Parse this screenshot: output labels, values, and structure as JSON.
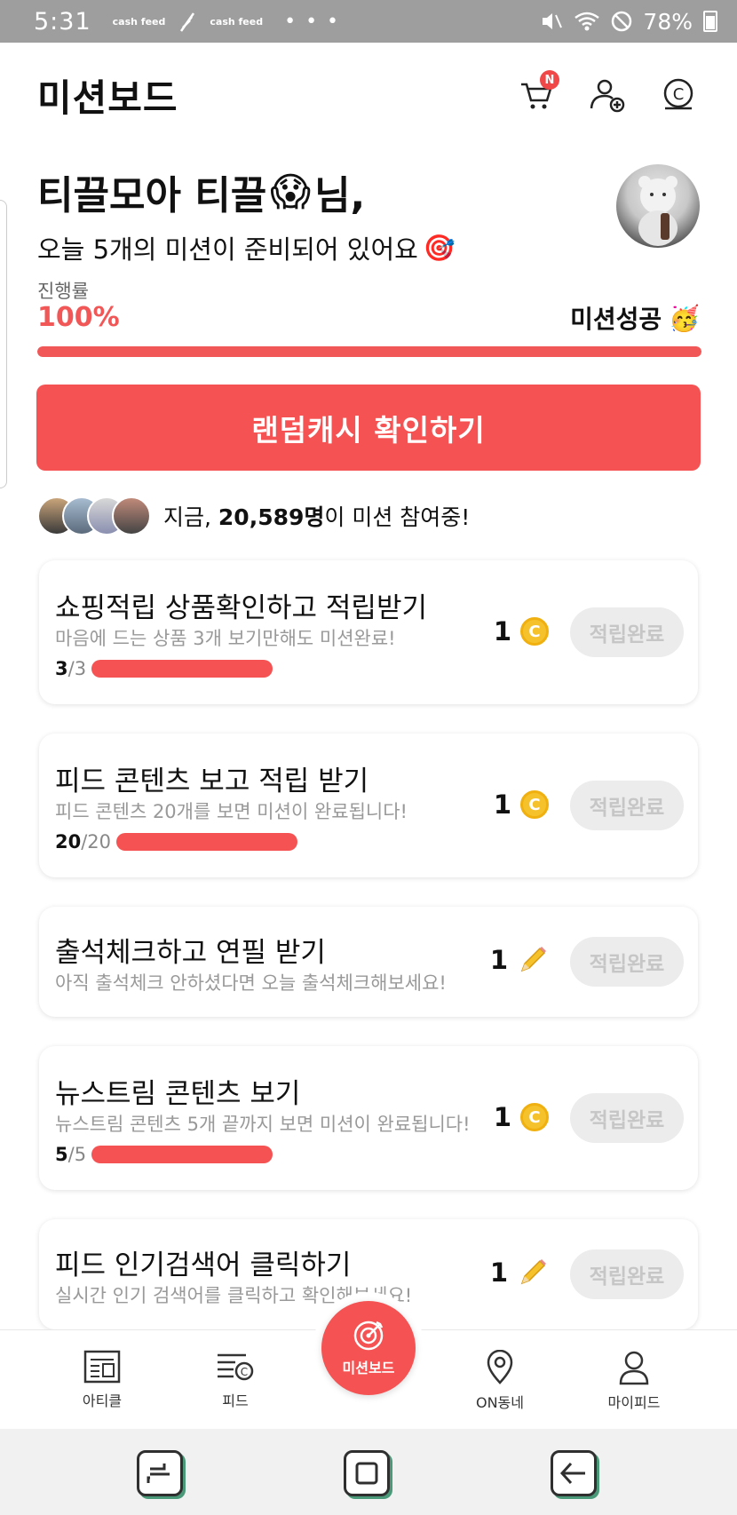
{
  "status_bar": {
    "time": "5:31",
    "notif_chips": [
      "cash feed",
      "cash feed"
    ],
    "more": "• • •",
    "battery": "78%"
  },
  "header": {
    "title": "미션보드",
    "cart_badge": "N"
  },
  "greeting": {
    "name": "티끌모아 티끌",
    "name_suffix": "님,",
    "emoji": "😱",
    "subtitle": "오늘 5개의 미션이 준비되어 있어요",
    "subtitle_emoji": "🎯"
  },
  "progress": {
    "label": "진행률",
    "percent_text": "100%",
    "fraction": 1.0,
    "success_label": "미션성공",
    "success_emoji": "🥳"
  },
  "cta": {
    "label": "랜덤캐시 확인하기"
  },
  "participants": {
    "prefix": "지금,",
    "count": "20,589명",
    "suffix": "이 미션 참여중!"
  },
  "missions": [
    {
      "title": "쇼핑적립 상품확인하고 적립받기",
      "desc": "마음에 드는 상품 3개 보기만해도 미션완료!",
      "progress_cur": "3",
      "progress_tot": "/3",
      "reward": "1",
      "reward_icon": "coin-icon",
      "status": "적립완료"
    },
    {
      "title": "피드 콘텐츠 보고 적립 받기",
      "desc": "피드 콘텐츠 20개를 보면 미션이 완료됩니다!",
      "progress_cur": "20",
      "progress_tot": "/20",
      "reward": "1",
      "reward_icon": "coin-icon",
      "status": "적립완료"
    },
    {
      "title": "출석체크하고 연필 받기",
      "desc": "아직 출석체크 안하셨다면 오늘 출석체크해보세요!",
      "progress_cur": "",
      "progress_tot": "",
      "reward": "1",
      "reward_icon": "pencil-icon",
      "status": "적립완료"
    },
    {
      "title": "뉴스트림 콘텐츠 보기",
      "desc": "뉴스트림 콘텐츠 5개 끝까지 보면 미션이 완료됩니다!",
      "progress_cur": "5",
      "progress_tot": "/5",
      "reward": "1",
      "reward_icon": "coin-icon",
      "status": "적립완료"
    },
    {
      "title": "피드 인기검색어 클릭하기",
      "desc": "실시간 인기 검색어를 클릭하고 확인해보세요!",
      "progress_cur": "",
      "progress_tot": "",
      "reward": "1",
      "reward_icon": "pencil-icon",
      "status": "적립완료"
    }
  ],
  "coin_glyph": "C",
  "bottom_nav": {
    "article": "아티클",
    "feed": "피드",
    "mission": "미션보드",
    "on": "ON동네",
    "my": "마이피드"
  },
  "colors": {
    "accent": "#f55353",
    "coin": "#f5c22b"
  }
}
